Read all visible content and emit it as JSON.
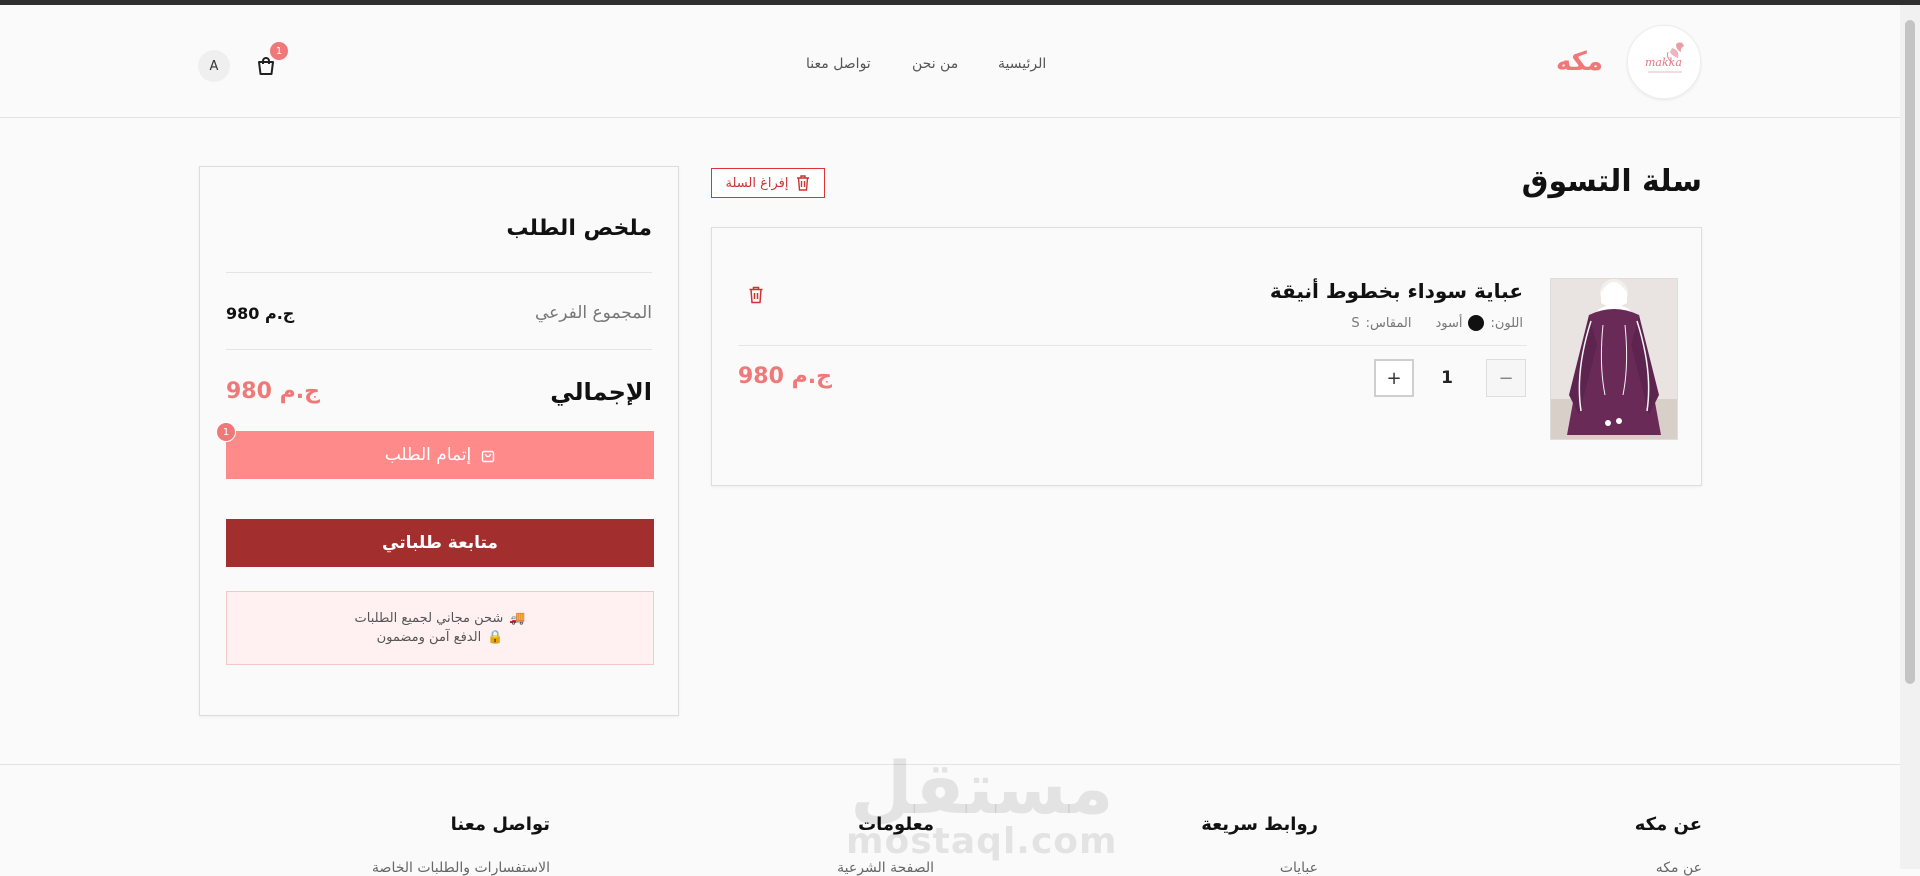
{
  "header": {
    "brand": "مكه",
    "logo_text": "makka",
    "nav": [
      "الرئيسية",
      "من نحن",
      "تواصل معنا"
    ],
    "cart_count": "1",
    "avatar_initial": "A"
  },
  "cart": {
    "title": "سلة التسوق",
    "empty_label": "إفراغ السلة",
    "item": {
      "name": "عباية سوداء بخطوط أنيقة",
      "color_label": "اللون:",
      "color_value": "أسود",
      "size_label": "المقاس:",
      "size_value": "S",
      "quantity": "1",
      "price": "980 ج.م",
      "minus": "−",
      "plus": "+"
    }
  },
  "summary": {
    "title": "ملخص الطلب",
    "subtotal_label": "المجموع الفرعي",
    "subtotal_value": "980 ج.م",
    "total_label": "الإجمالي",
    "total_value": "980 ج.م",
    "checkout_label": "إتمام الطلب",
    "checkout_badge": "1",
    "track_label": "متابعة طلباتي",
    "shipping_note": "شحن مجاني لجميع الطلبات",
    "payment_note": "الدفع آمن ومضمون"
  },
  "footer": {
    "columns": [
      "عن مكه",
      "روابط سريعة",
      "معلومات",
      "تواصل معنا"
    ],
    "links": [
      "عن مكه",
      "عبايات",
      "الصفحة الشرعية",
      "الاستفسارات والطلبات الخاصة"
    ]
  },
  "watermark": {
    "arabic": "مستقل",
    "latin": "mostaql.com"
  },
  "colors": {
    "accent": "#f07878",
    "checkout": "#ff8a8a",
    "track": "#a32e2e",
    "danger": "#cc3333"
  }
}
